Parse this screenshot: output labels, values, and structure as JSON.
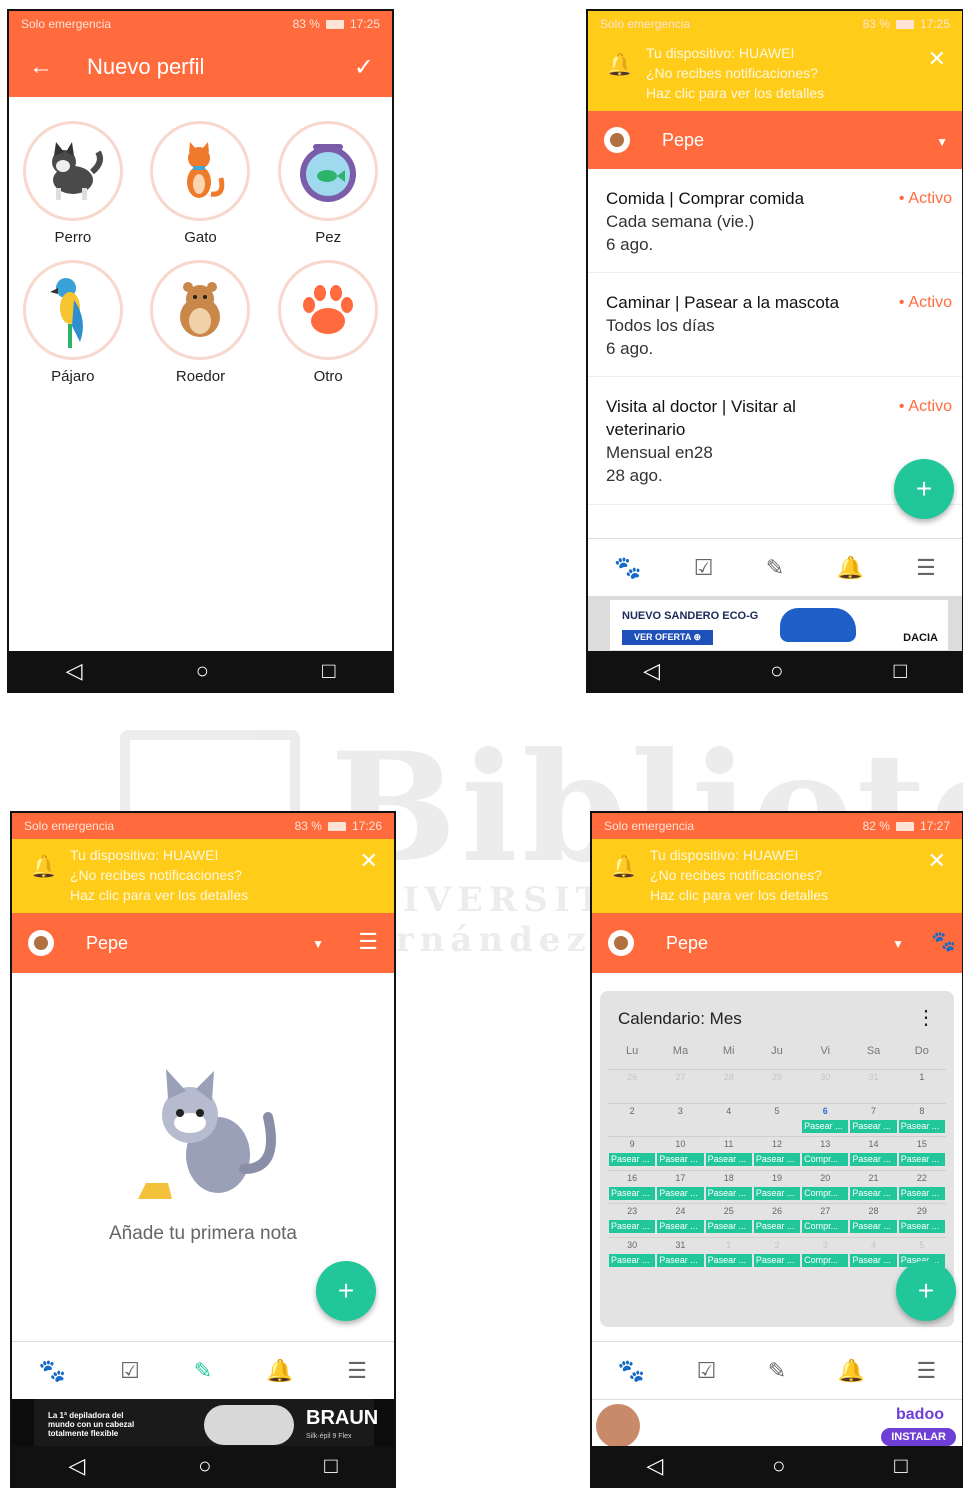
{
  "status": {
    "p1": {
      "left": "Solo emergencia",
      "battery": "83 %",
      "time": "17:25"
    },
    "p2": {
      "left": "Solo emergencia",
      "battery": "83 %",
      "time": "17:25"
    },
    "p3": {
      "left": "Solo emergencia",
      "battery": "83 %",
      "time": "17:26"
    },
    "p4": {
      "left": "Solo emergencia",
      "battery": "82 %",
      "time": "17:27"
    }
  },
  "new_profile": {
    "title": "Nuevo perfil",
    "animals": [
      "Perro",
      "Gato",
      "Pez",
      "Pájaro",
      "Roedor",
      "Otro"
    ]
  },
  "notice": {
    "line1": "Tu dispositivo: HUAWEI",
    "line2": "¿No recibes notificaciones?",
    "line3": "Haz clic para ver los detalles"
  },
  "pet_name": "Pepe",
  "reminders": [
    {
      "title": "Comida | Comprar comida",
      "freq": "Cada semana (vie.)",
      "date": "6 ago.",
      "status": "Activo"
    },
    {
      "title": "Caminar | Pasear a la mascota",
      "freq": "Todos los días",
      "date": "6 ago.",
      "status": "Activo"
    },
    {
      "title": "Visita al doctor | Visitar al",
      "title2": "veterinario",
      "freq": "Mensual en28",
      "date": "28 ago.",
      "status": "Activo"
    }
  ],
  "ads": {
    "dacia": {
      "headline": "NUEVO SANDERO ECO-G",
      "cta": "VER OFERTA ⊕",
      "brand": "DACIA"
    },
    "braun": {
      "copy1": "La 1ª depiladora del",
      "copy2": "mundo con un cabezal",
      "copy3": "totalmente flexible",
      "brand": "BRAUN",
      "product": "Silk·épil 9 Flex"
    },
    "badoo": {
      "brand": "badoo",
      "cta": "INSTALAR"
    }
  },
  "notes": {
    "empty": "Añade tu primera nota"
  },
  "calendar": {
    "title": "Calendario: Mes",
    "day_heads": [
      "Lu",
      "Ma",
      "Mi",
      "Ju",
      "Vi",
      "Sa",
      "Do"
    ],
    "weeks": [
      [
        {
          "d": "26",
          "f": true
        },
        {
          "d": "27",
          "f": true
        },
        {
          "d": "28",
          "f": true
        },
        {
          "d": "29",
          "f": true
        },
        {
          "d": "30",
          "f": true
        },
        {
          "d": "31",
          "f": true
        },
        {
          "d": "1"
        }
      ],
      [
        {
          "d": "2"
        },
        {
          "d": "3"
        },
        {
          "d": "4"
        },
        {
          "d": "5"
        },
        {
          "d": "6",
          "today": true,
          "ev": "Pasear ..."
        },
        {
          "d": "7",
          "ev": "Pasear ..."
        },
        {
          "d": "8",
          "ev": "Pasear ..."
        }
      ],
      [
        {
          "d": "9",
          "ev": "Pasear ..."
        },
        {
          "d": "10",
          "ev": "Pasear ..."
        },
        {
          "d": "11",
          "ev": "Pasear ..."
        },
        {
          "d": "12",
          "ev": "Pasear ..."
        },
        {
          "d": "13",
          "ev": "Compr..."
        },
        {
          "d": "14",
          "ev": "Pasear ..."
        },
        {
          "d": "15",
          "ev": "Pasear ..."
        }
      ],
      [
        {
          "d": "16",
          "ev": "Pasear ..."
        },
        {
          "d": "17",
          "ev": "Pasear ..."
        },
        {
          "d": "18",
          "ev": "Pasear ..."
        },
        {
          "d": "19",
          "ev": "Pasear ..."
        },
        {
          "d": "20",
          "ev": "Compr..."
        },
        {
          "d": "21",
          "ev": "Pasear ..."
        },
        {
          "d": "22",
          "ev": "Pasear ..."
        }
      ],
      [
        {
          "d": "23",
          "ev": "Pasear ..."
        },
        {
          "d": "24",
          "ev": "Pasear ..."
        },
        {
          "d": "25",
          "ev": "Pasear ..."
        },
        {
          "d": "26",
          "ev": "Pasear ..."
        },
        {
          "d": "27",
          "ev": "Compr..."
        },
        {
          "d": "28",
          "ev": "Pasear ..."
        },
        {
          "d": "29",
          "ev": "Pasear ..."
        }
      ],
      [
        {
          "d": "30",
          "ev": "Pasear ..."
        },
        {
          "d": "31",
          "ev": "Pasear ..."
        },
        {
          "d": "1",
          "f": true,
          "ev": "Pasear ..."
        },
        {
          "d": "2",
          "f": true,
          "ev": "Pasear ..."
        },
        {
          "d": "3",
          "f": true,
          "ev": "Compr..."
        },
        {
          "d": "4",
          "f": true,
          "ev": "Pasear ..."
        },
        {
          "d": "5",
          "f": true,
          "ev": "Pasear ..."
        }
      ]
    ]
  },
  "watermark": {
    "big": "Biblioteca",
    "small": "UNIVERSITAS Miguel Hernández"
  },
  "icons": {
    "back": "arrow-left-icon",
    "check": "check-icon",
    "bell": "bell-icon",
    "close": "close-icon",
    "paw": "paw-icon",
    "checklist": "checklist-icon",
    "pencil": "pencil-icon",
    "menu": "menu-icon",
    "plus": "plus-icon"
  },
  "colors": {
    "primary": "#ff6b3d",
    "notice": "#ffcc1a",
    "accent": "#21c79a"
  }
}
